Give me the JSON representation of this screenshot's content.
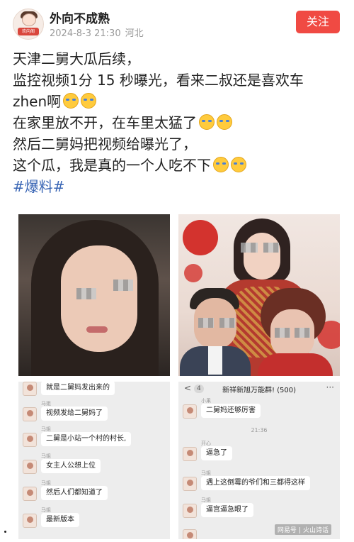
{
  "header": {
    "user_name": "外向不成熟",
    "date": "2024-8-3 21:30",
    "location": "河北",
    "follow_label": "关注",
    "avatar_tag": "欢向阁"
  },
  "post": {
    "lines": [
      "天津二舅大瓜后续，",
      "监控视频1分 15 秒曝光，看来二叔还是喜欢车",
      "zhen啊",
      "在家里放不开，在车里太猛了",
      "然后二舅妈把视频给曝光了，",
      "这个瓜，我是真的一个人吃不下"
    ],
    "emoji_icon": "crying-laughing-emoji-icon",
    "hashtag": "#爆料#"
  },
  "chat_left": {
    "messages": [
      {
        "sender": "",
        "text": "就是二舅妈发出来的"
      },
      {
        "sender": "马姐",
        "text": "视频发给二舅妈了"
      },
      {
        "sender": "马姐",
        "text": "二舅是小站一个村的村长,"
      },
      {
        "sender": "马姐",
        "text": "女主人公想上位"
      },
      {
        "sender": "马姐",
        "text": "然后人们都知道了"
      },
      {
        "sender": "马姐",
        "text": "最新版本"
      }
    ]
  },
  "chat_right": {
    "back": "<",
    "badge": "4",
    "title": "新祥新旭万能群! (500)",
    "more": "···",
    "time": "21:36",
    "messages": [
      {
        "sender": "小果",
        "text": "二舅妈还够厉害"
      },
      {
        "sender": "开心",
        "text": "逼急了"
      },
      {
        "sender": "马姐",
        "text": "遇上这倒霉的爷们和三都得这样"
      },
      {
        "sender": "马姐",
        "text": "逼宫逼急眼了"
      }
    ]
  },
  "watermark": {
    "left": "网易号",
    "right": "火山诗话"
  },
  "colors": {
    "follow": "#f04a43",
    "hashtag": "#3a66b5",
    "chat_bg": "#ededed"
  }
}
